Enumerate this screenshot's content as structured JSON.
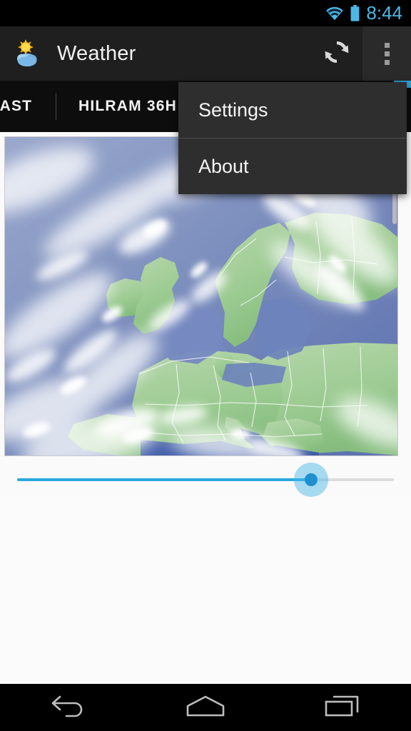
{
  "status_bar": {
    "time": "8:44",
    "icons": [
      "wifi-icon",
      "battery-icon"
    ],
    "time_color": "#4cb8e8",
    "background": "#000000"
  },
  "action_bar": {
    "app_icon": "sun-cloud-icon",
    "title": "Weather",
    "refresh_icon": "refresh-icon",
    "overflow_icon": "overflow-menu-icon",
    "background": "#1f1f1f"
  },
  "tabs": {
    "items": [
      {
        "label": "ECAST"
      },
      {
        "label": "HILRAM 36H"
      }
    ],
    "indicator_color": "#2aa3d4",
    "background": "#0d0d0d"
  },
  "map": {
    "name": "satellite-weather-map",
    "region": "Europe",
    "scrollbar_visible": true
  },
  "slider": {
    "name": "time-slider",
    "value_percent": 78,
    "fill_color": "#29a8e0",
    "track_color": "#dcdcdc",
    "thumb_color": "#1f8fd0",
    "halo_color": "#4cb8e8"
  },
  "overflow_menu": {
    "open": true,
    "items": [
      {
        "label": "Settings"
      },
      {
        "label": "About"
      }
    ],
    "background": "#2e2e2e"
  },
  "nav_bar": {
    "buttons": [
      {
        "icon": "back-icon"
      },
      {
        "icon": "home-icon"
      },
      {
        "icon": "recents-icon"
      }
    ],
    "background": "#000000"
  }
}
